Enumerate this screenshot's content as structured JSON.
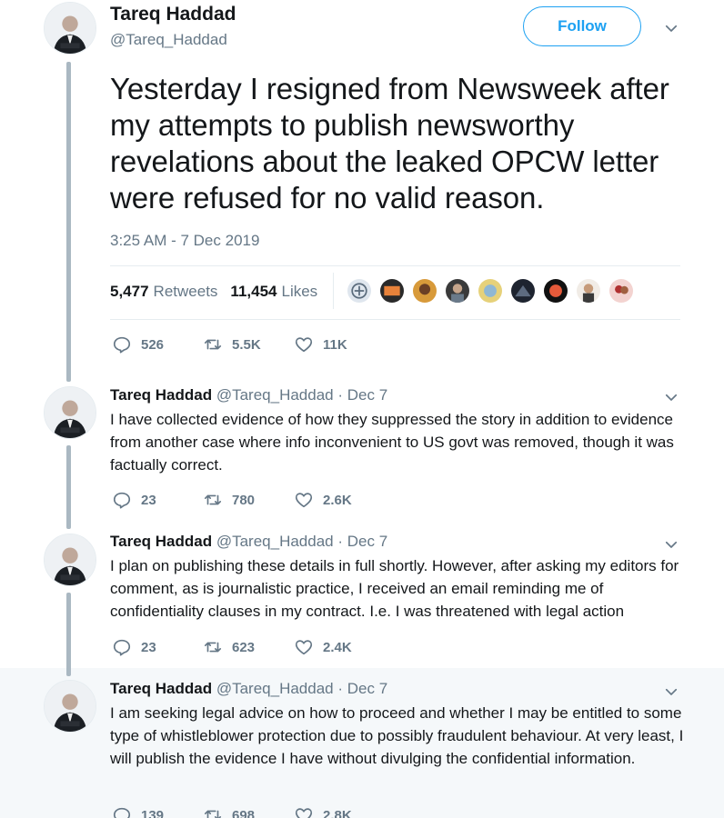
{
  "main_tweet": {
    "author_name": "Tareq Haddad",
    "author_handle": "@Tareq_Haddad",
    "follow_label": "Follow",
    "text": "Yesterday I resigned from Newsweek after my attempts to publish newsworthy revelations about the leaked OPCW letter were refused for no valid reason.",
    "timestamp": "3:25 AM - 7 Dec 2019",
    "retweets_count": "5,477",
    "retweets_label": "Retweets",
    "likes_count": "11,454",
    "likes_label": "Likes",
    "replies": "526",
    "retweets_short": "5.5K",
    "likes_short": "11K"
  },
  "replies": [
    {
      "name": "Tareq Haddad",
      "handle": "@Tareq_Haddad",
      "date": "· Dec 7",
      "text": "I have collected evidence of how they suppressed the story in addition to evidence from another case where info inconvenient to US govt was removed, though it was factually correct.",
      "replies": "23",
      "retweets": "780",
      "likes": "2.6K"
    },
    {
      "name": "Tareq Haddad",
      "handle": "@Tareq_Haddad",
      "date": "· Dec 7",
      "text": "I plan on publishing these details in full shortly. However, after asking my editors for comment, as is journalistic practice, I received an email reminding me of confidentiality clauses in my contract. I.e. I was threatened with legal action",
      "replies": "23",
      "retweets": "623",
      "likes": "2.4K"
    },
    {
      "name": "Tareq Haddad",
      "handle": "@Tareq_Haddad",
      "date": "· Dec 7",
      "text": "I am seeking legal advice on how to proceed and whether I may be entitled to some type of whistleblower protection due to possibly fraudulent behaviour. At very least, I will publish the evidence I have without divulging the confidential information.",
      "replies": "139",
      "retweets": "698",
      "likes": "2.8K"
    }
  ],
  "colors": {
    "accent": "#1da1f2",
    "text": "#14171a",
    "muted": "#657786",
    "thread_line": "#aab8c2",
    "highlight_bg": "#f5f8fa"
  },
  "icons": [
    "reply-icon",
    "retweet-icon",
    "like-icon",
    "chevron-down-icon",
    "avatar"
  ]
}
